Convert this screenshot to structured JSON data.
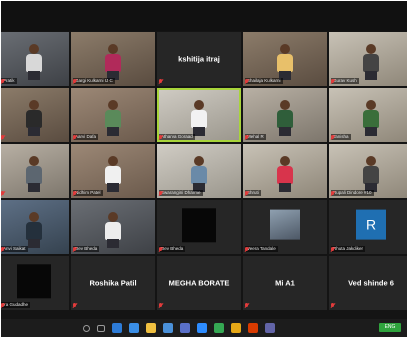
{
  "participants": [
    {
      "name": "Pratik",
      "kind": "video",
      "room": "room-c",
      "shirt": "#d8d8d8",
      "muted": true
    },
    {
      "name": "Gargi Kulkarni IJ C",
      "kind": "video",
      "room": "room-a",
      "shirt": "#b12a5a",
      "muted": true
    },
    {
      "name": "kshitija itraj",
      "kind": "name",
      "muted": true
    },
    {
      "name": "Shailaja Kulkarni",
      "kind": "video",
      "room": "room-a",
      "shirt": "#e8c06a",
      "muted": true
    },
    {
      "name": "Gurav Kush",
      "kind": "video",
      "room": "room-e",
      "shirt": "#444444",
      "muted": true
    },
    {
      "name": "",
      "kind": "video",
      "room": "room-a",
      "shirt": "#2a2a2a",
      "muted": true
    },
    {
      "name": "Aarvi Dafa",
      "kind": "video",
      "room": "room-d",
      "shirt": "#5a8a5a",
      "muted": true
    },
    {
      "name": "Atharva Goraad",
      "kind": "video",
      "room": "room-f",
      "shirt": "#f2f2f2",
      "muted": true,
      "active": true
    },
    {
      "name": "Mehal R",
      "kind": "video",
      "room": "room-b",
      "shirt": "#2f5e3a",
      "muted": true
    },
    {
      "name": "Tanisha",
      "kind": "video",
      "room": "room-e",
      "shirt": "#3a6e3a",
      "muted": true
    },
    {
      "name": "",
      "kind": "video",
      "room": "room-b",
      "shirt": "#5c6670",
      "muted": true
    },
    {
      "name": "Nidhim Patel",
      "kind": "video",
      "room": "room-d",
      "shirt": "#f0f0f0",
      "muted": true
    },
    {
      "name": "Swarangini Dharme",
      "kind": "video",
      "room": "room-f",
      "shirt": "#6a8aa8",
      "muted": true
    },
    {
      "name": "Shruti",
      "kind": "video",
      "room": "room-e",
      "shirt": "#d8344c",
      "muted": true
    },
    {
      "name": "Rupali Dindore #10",
      "kind": "video",
      "room": "room-e",
      "shirt": "#444444",
      "muted": true
    },
    {
      "name": "Anvi Saikat",
      "kind": "video",
      "room": "room-g",
      "shirt": "#24303c",
      "muted": true
    },
    {
      "name": "Dev Bheda",
      "kind": "video",
      "room": "room-c",
      "shirt": "#ededed",
      "muted": true
    },
    {
      "name": "Dev Bheda",
      "kind": "square",
      "muted": true
    },
    {
      "name": "Veera Tandale",
      "kind": "photo",
      "muted": true
    },
    {
      "name": "Rhuta Jakdiker",
      "kind": "letter",
      "letter": "R",
      "muted": true
    },
    {
      "name": "Ira Gudadhe",
      "kind": "square",
      "muted": true
    },
    {
      "name": "Roshika Patil",
      "kind": "name",
      "muted": true
    },
    {
      "name": "MEGHA  BORATE",
      "kind": "name",
      "muted": true
    },
    {
      "name": "Mi A1",
      "kind": "name",
      "muted": true
    },
    {
      "name": "Ved shinde 6",
      "kind": "name",
      "muted": true
    }
  ],
  "taskbar": {
    "icons": [
      "windows-icon",
      "search-icon",
      "task-view-icon",
      "edge-icon",
      "store-icon",
      "folder-icon",
      "mail-icon",
      "photos-icon",
      "zoom-icon",
      "chrome-icon",
      "media-icon",
      "office-icon",
      "teams-icon"
    ],
    "colors": [
      "#ffffff",
      "#9a9a9a",
      "#9a9a9a",
      "#2d7bd6",
      "#3a8ee6",
      "#f0c040",
      "#4a90d9",
      "#5a70c8",
      "#2d8cff",
      "#35a853",
      "#e6a817",
      "#d83b01",
      "#6264a7"
    ],
    "tray_label": "ENG"
  }
}
